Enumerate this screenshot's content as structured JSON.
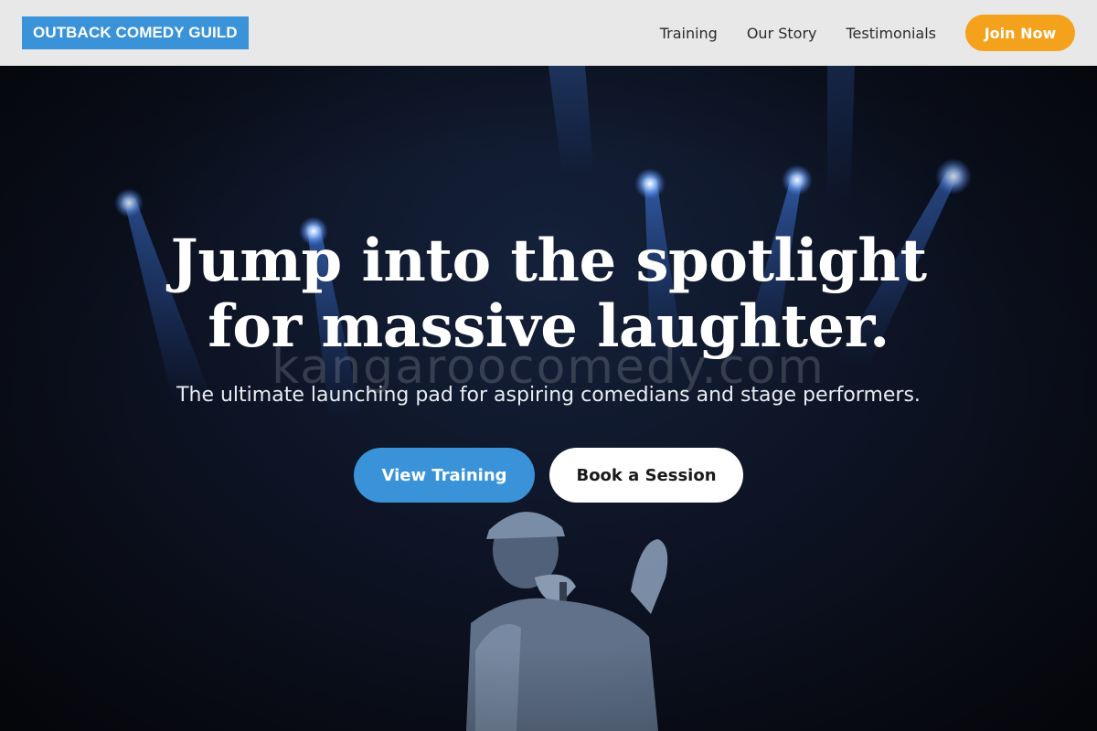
{
  "header": {
    "logo": "OUTBACK COMEDY GUILD",
    "nav": [
      {
        "label": "Training"
      },
      {
        "label": "Our Story"
      },
      {
        "label": "Testimonials"
      }
    ],
    "cta": "Join Now"
  },
  "hero": {
    "headline_line1": "Jump into the spotlight",
    "headline_line2": "for massive laughter.",
    "watermark": "kangaroocomedy.com",
    "subtitle": "The ultimate launching pad for aspiring comedians and stage performers.",
    "primary_button": "View Training",
    "secondary_button": "Book a Session"
  },
  "colors": {
    "header_bg": "#e8e8e8",
    "logo_bg": "#3a93d8",
    "accent_orange": "#f4a11b",
    "accent_blue": "#3a93d8",
    "hero_bg": "#0c1120"
  },
  "icons": [
    "stage-spotlights",
    "comedian-with-microphone"
  ]
}
